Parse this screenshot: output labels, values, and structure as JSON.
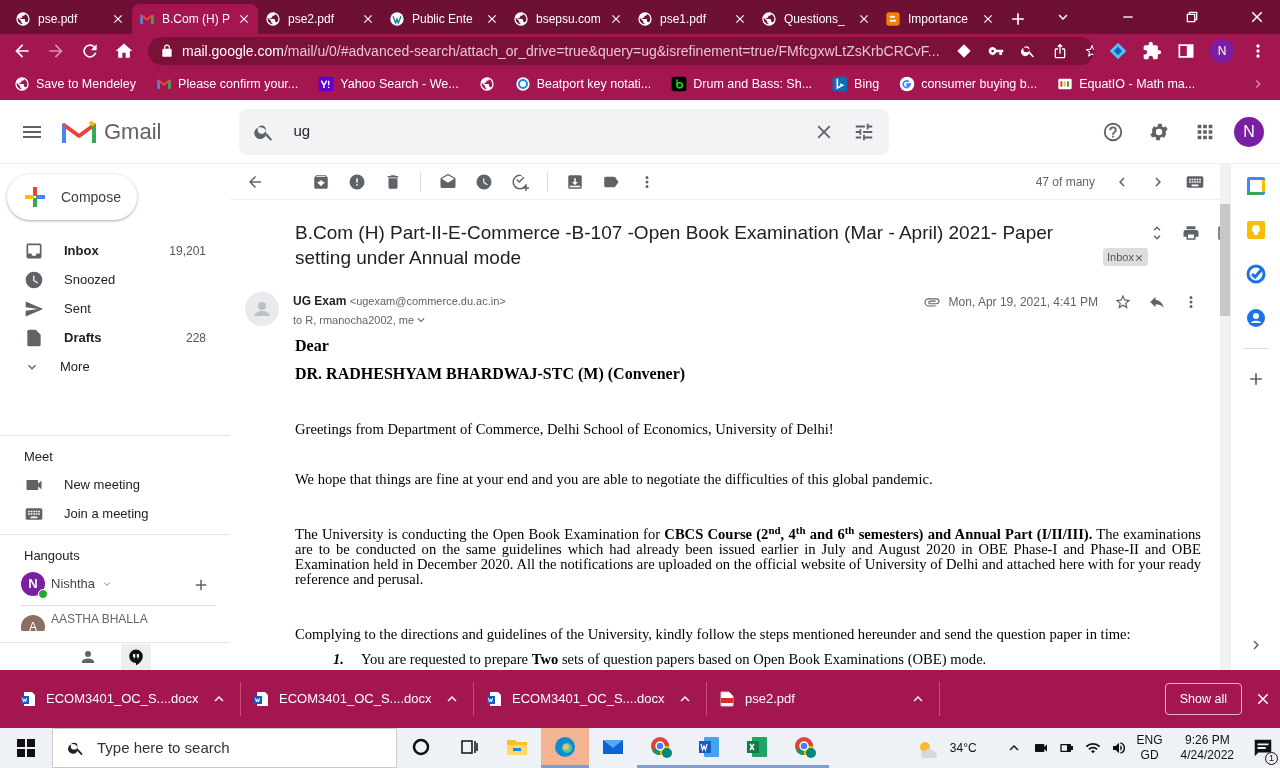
{
  "browser": {
    "tabs": [
      {
        "title": "pse.pdf",
        "selected": false
      },
      {
        "title": "B.Com (H) P",
        "selected": true
      },
      {
        "title": "pse2.pdf",
        "selected": false
      },
      {
        "title": "Public Ente",
        "selected": false
      },
      {
        "title": "bsepsu.com",
        "selected": false
      },
      {
        "title": "pse1.pdf",
        "selected": false
      },
      {
        "title": "Questions_",
        "selected": false
      },
      {
        "title": "Importance",
        "selected": false
      }
    ],
    "address": {
      "host": "mail.google.com",
      "path": "/mail/u/0/#advanced-search/attach_or_drive=true&query=ug&isrefinement=true/FMfcgxwLtZsKrbCRCvF..."
    },
    "profile": "N",
    "bookmarks": [
      "Save to Mendeley",
      "Please confirm your...",
      "Yahoo Search - We...",
      "Beatport key notati...",
      "Drum and Bass: Sh...",
      "Bing",
      "consumer buying b...",
      "EquatIO - Math ma..."
    ]
  },
  "gmail": {
    "logo": "Gmail",
    "search": {
      "value": "ug"
    },
    "avatar": "N",
    "compose": "Compose",
    "folders": [
      {
        "label": "Inbox",
        "count": "19,201",
        "bold": true
      },
      {
        "label": "Snoozed",
        "bold": false
      },
      {
        "label": "Sent",
        "bold": false
      },
      {
        "label": "Drafts",
        "count": "228",
        "bold": true
      },
      {
        "label": "More",
        "bold": false
      }
    ],
    "meet": {
      "heading": "Meet",
      "items": [
        "New meeting",
        "Join a meeting"
      ]
    },
    "hangouts": {
      "heading": "Hangouts",
      "user": {
        "initial": "N",
        "name": "Nishtha",
        "online": true
      },
      "contacts": [
        {
          "initial": "A",
          "name": "AASTHA BHALLA"
        }
      ]
    },
    "counter": "47 of many",
    "email": {
      "subject": "B.Com (H) Part-II-E-Commerce -B-107 -Open Book Examination (Mar - April) 2021- Paper setting under Annual mode",
      "label": "Inbox",
      "sender_name": "UG Exam",
      "sender_email": "<ugexam@commerce.du.ac.in>",
      "recipients": "to R, rmanocha2002, me",
      "date": "Mon, Apr 19, 2021, 4:41 PM",
      "salutation": "Dear",
      "addressee": "DR. RADHESHYAM BHARDWAJ-STC (M) (Convener)",
      "paragraphs": [
        "Greetings from Department of Commerce, Delhi School of Economics, University of Delhi!",
        "We hope that things are fine at your end and you are able to negotiate the difficulties of this global pandemic.",
        "The University is conducting the Open Book Examination for **CBCS Course (2$^{nd}$, 4$^{th}$ and 6$^{th}$ semesters) and Annual Part (I/II/III).** The examinations are to be conducted on the same guidelines which had already been issued earlier in July and August 2020 in OBE Phase-I and Phase-II and OBE Examination held in December 2020. All the notifications are uploaded on the official website of University of Delhi and attached here with for your ready reference and perusal.",
        "Complying to the directions and guidelines of the University, kindly follow the steps mentioned hereunder and send the question paper in time:"
      ],
      "steps": [
        {
          "number": "1.",
          "text": "You are requested to prepare **Two** sets of question papers based on Open Book Examinations (OBE) mode."
        }
      ]
    }
  },
  "downloads": {
    "files": [
      {
        "name": "ECOM3401_OC_S....docx",
        "kind": "word"
      },
      {
        "name": "ECOM3401_OC_S....docx",
        "kind": "word"
      },
      {
        "name": "ECOM3401_OC_S....docx",
        "kind": "word"
      },
      {
        "name": "pse2.pdf",
        "kind": "pdf"
      }
    ],
    "show_all": "Show all"
  },
  "taskbar": {
    "search_placeholder": "Type here to search",
    "apps": [
      {
        "kind": "cortana",
        "running": false,
        "active": false
      },
      {
        "kind": "taskview",
        "running": false,
        "active": false
      },
      {
        "kind": "folder",
        "running": false,
        "active": false
      },
      {
        "kind": "edge",
        "running": true,
        "active": true
      },
      {
        "kind": "mail",
        "running": false,
        "active": false
      },
      {
        "kind": "chrome",
        "running": true,
        "active": false
      },
      {
        "kind": "word",
        "running": true,
        "active": false
      },
      {
        "kind": "excel",
        "running": true,
        "active": false
      },
      {
        "kind": "chrome",
        "running": true,
        "active": false
      }
    ],
    "temperature": "34°C",
    "language": "ENG",
    "layout": "GD",
    "time": "9:26 PM",
    "date": "4/24/2022",
    "notifications": "1"
  }
}
